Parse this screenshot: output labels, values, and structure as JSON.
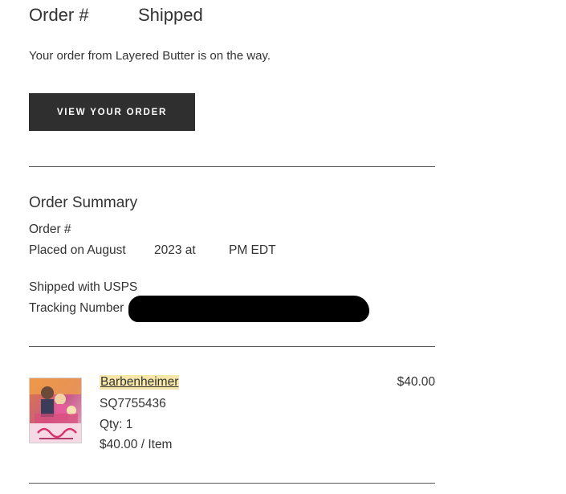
{
  "header": {
    "order_label": "Order #",
    "status": "Shipped"
  },
  "intro_text": "Your order from Layered Butter is on the way.",
  "view_order_button": "VIEW YOUR ORDER",
  "summary": {
    "heading": "Order Summary",
    "order_number_label": "Order #",
    "placed": {
      "prefix": "Placed on August",
      "year": "2023 at",
      "tz": "PM EDT"
    },
    "shipped_with": "Shipped with USPS",
    "tracking_label": "Tracking Number"
  },
  "item": {
    "name": "Barbenheimer",
    "sku": "SQ7755436",
    "qty": "Qty: 1",
    "unit_price": "$40.00 / Item",
    "price": "$40.00",
    "image_icon": "movie-poster-thumbnail",
    "image_caption": "Barbenheimer"
  },
  "colors": {
    "button_bg": "#2f2f2f",
    "link_highlight": "#f6e7a9",
    "text": "#333333",
    "redaction": "#000000"
  }
}
